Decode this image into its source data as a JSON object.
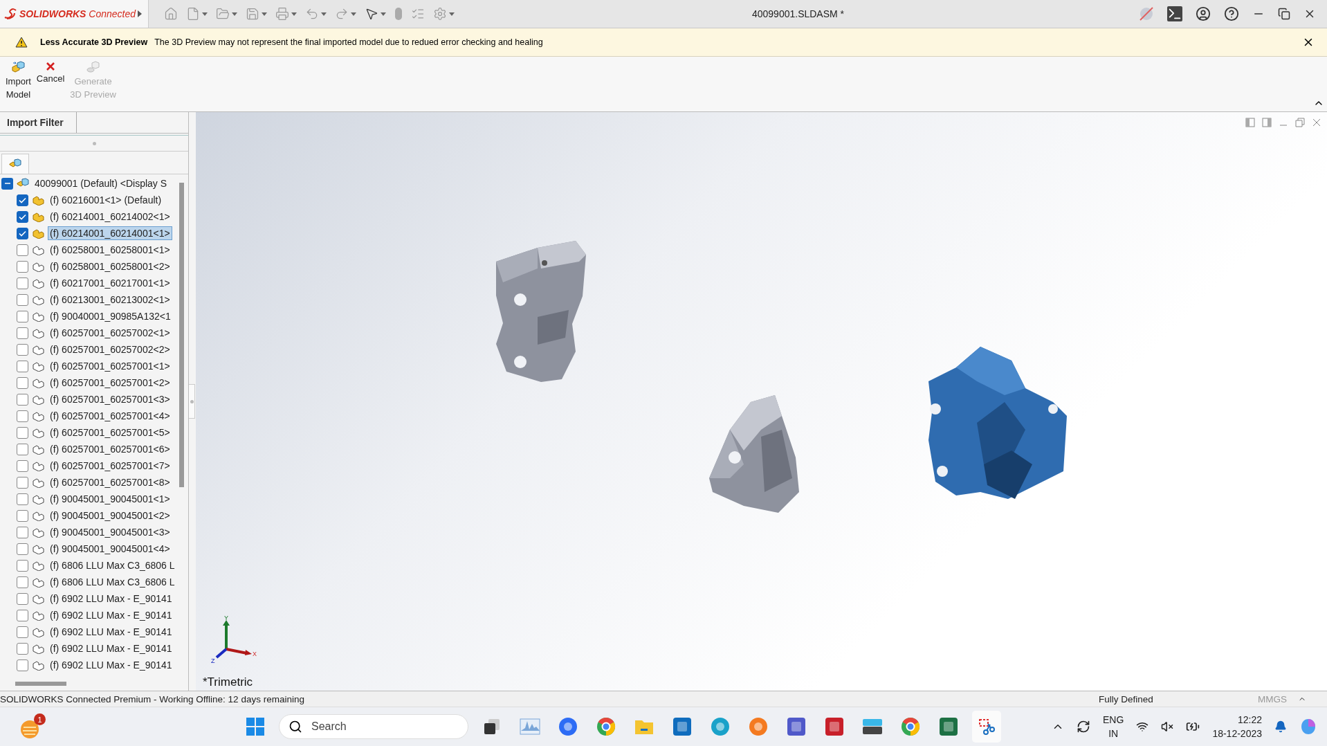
{
  "title_bar": {
    "app_name": "**SOLIDWORKS** Connected",
    "document_title": "40099001.SLDASM *"
  },
  "notice": {
    "title": "Less Accurate 3D Preview",
    "message": "The 3D Preview may not represent the final imported model due to redued error checking and healing"
  },
  "commands": [
    {
      "kind": "import",
      "lines": [
        "Import",
        "Model"
      ],
      "disabled": false
    },
    {
      "kind": "cancel",
      "lines": [
        "Cancel"
      ],
      "disabled": false
    },
    {
      "kind": "generate",
      "lines": [
        "Generate",
        "3D Preview"
      ],
      "disabled": true
    }
  ],
  "panel": {
    "tab": "Import Filter"
  },
  "tree": {
    "root": {
      "label": "40099001 (Default) <Display S",
      "expanded": true,
      "children": [
        {
          "label": "(f) 60216001<1> (Default)",
          "checked": true,
          "selected": false
        },
        {
          "label": "(f) 60214001_60214002<1>",
          "checked": true,
          "selected": false
        },
        {
          "label": "(f) 60214001_60214001<1>",
          "checked": true,
          "selected": true
        },
        {
          "label": "(f) 60258001_60258001<1>",
          "checked": false,
          "selected": false
        },
        {
          "label": "(f) 60258001_60258001<2>",
          "checked": false,
          "selected": false
        },
        {
          "label": "(f) 60217001_60217001<1>",
          "checked": false,
          "selected": false
        },
        {
          "label": "(f) 60213001_60213002<1>",
          "checked": false,
          "selected": false
        },
        {
          "label": "(f) 90040001_90985A132<1",
          "checked": false,
          "selected": false
        },
        {
          "label": "(f) 60257001_60257002<1>",
          "checked": false,
          "selected": false
        },
        {
          "label": "(f) 60257001_60257002<2>",
          "checked": false,
          "selected": false
        },
        {
          "label": "(f) 60257001_60257001<1>",
          "checked": false,
          "selected": false
        },
        {
          "label": "(f) 60257001_60257001<2>",
          "checked": false,
          "selected": false
        },
        {
          "label": "(f) 60257001_60257001<3>",
          "checked": false,
          "selected": false
        },
        {
          "label": "(f) 60257001_60257001<4>",
          "checked": false,
          "selected": false
        },
        {
          "label": "(f) 60257001_60257001<5>",
          "checked": false,
          "selected": false
        },
        {
          "label": "(f) 60257001_60257001<6>",
          "checked": false,
          "selected": false
        },
        {
          "label": "(f) 60257001_60257001<7>",
          "checked": false,
          "selected": false
        },
        {
          "label": "(f) 60257001_60257001<8>",
          "checked": false,
          "selected": false
        },
        {
          "label": "(f) 90045001_90045001<1>",
          "checked": false,
          "selected": false
        },
        {
          "label": "(f) 90045001_90045001<2>",
          "checked": false,
          "selected": false
        },
        {
          "label": "(f) 90045001_90045001<3>",
          "checked": false,
          "selected": false
        },
        {
          "label": "(f) 90045001_90045001<4>",
          "checked": false,
          "selected": false
        },
        {
          "label": "(f) 6806 LLU Max C3_6806 L",
          "checked": false,
          "selected": false
        },
        {
          "label": "(f) 6806 LLU Max C3_6806 L",
          "checked": false,
          "selected": false
        },
        {
          "label": "(f) 6902 LLU Max - E_90141",
          "checked": false,
          "selected": false
        },
        {
          "label": "(f) 6902 LLU Max - E_90141",
          "checked": false,
          "selected": false
        },
        {
          "label": "(f) 6902 LLU Max - E_90141",
          "checked": false,
          "selected": false
        },
        {
          "label": "(f) 6902 LLU Max - E_90141",
          "checked": false,
          "selected": false
        },
        {
          "label": "(f) 6902 LLU Max - E_90141",
          "checked": false,
          "selected": false
        }
      ]
    }
  },
  "viewport": {
    "view_name": "*Trimetric",
    "axes": {
      "x": "X",
      "y": "Y",
      "z": "Z"
    }
  },
  "status_bar": {
    "message": "SOLIDWORKS Connected Premium - Working Offline: 12 days remaining",
    "state": "Fully Defined",
    "units": "MMGS"
  },
  "taskbar": {
    "notification_count": "1",
    "search_placeholder": "Search",
    "language": "ENG",
    "region": "IN",
    "time": "12:22",
    "date": "18-12-2023"
  }
}
